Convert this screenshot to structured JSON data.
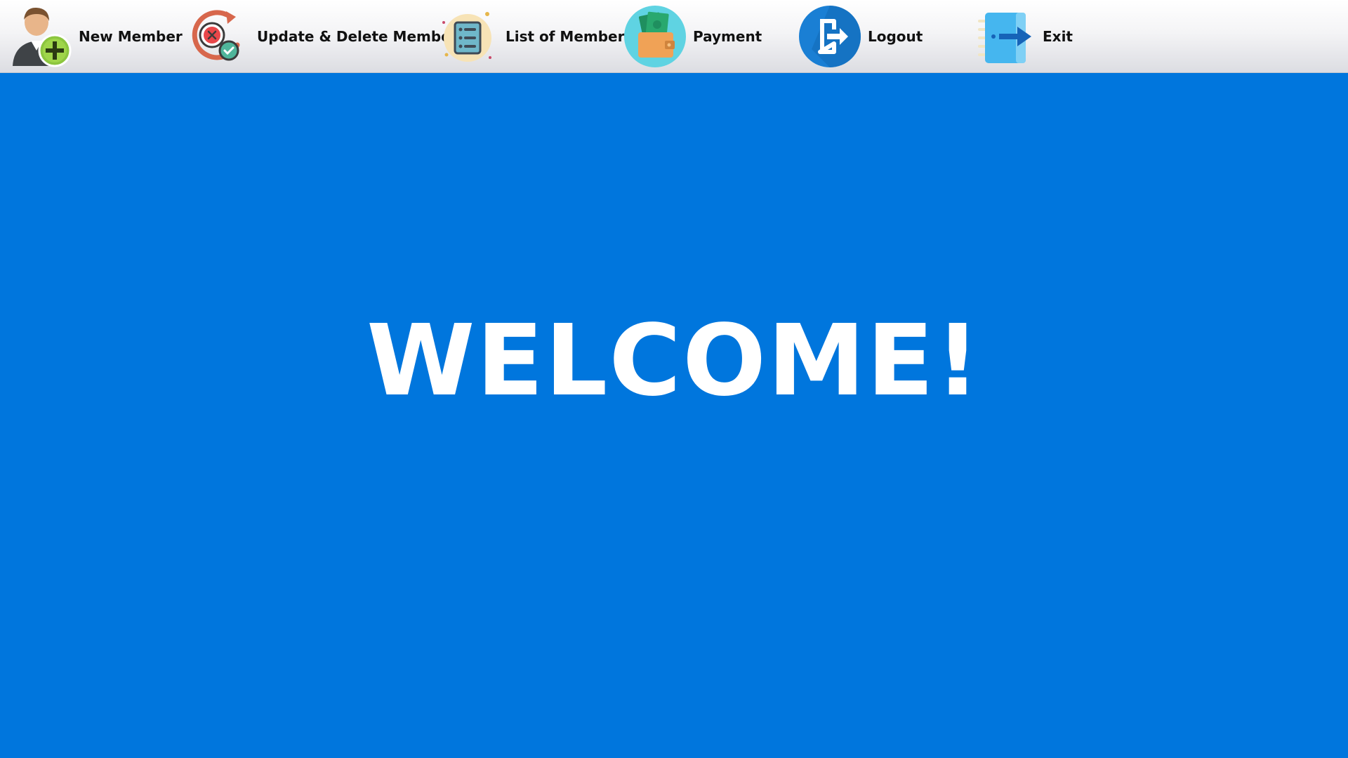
{
  "menu": {
    "items": [
      {
        "label": "New Member",
        "icon": "new-member-icon"
      },
      {
        "label": "Update & Delete Member",
        "icon": "update-delete-icon"
      },
      {
        "label": "List of Members",
        "icon": "member-list-icon"
      },
      {
        "label": "Payment",
        "icon": "wallet-payment-icon"
      },
      {
        "label": "Logout",
        "icon": "logout-icon"
      },
      {
        "label": "Exit",
        "icon": "exit-icon"
      }
    ]
  },
  "main": {
    "welcome_text": "WELCOME!"
  },
  "colors": {
    "background": "#0076dd",
    "menubar": "#f0f0f2",
    "welcome_text": "#ffffff"
  }
}
